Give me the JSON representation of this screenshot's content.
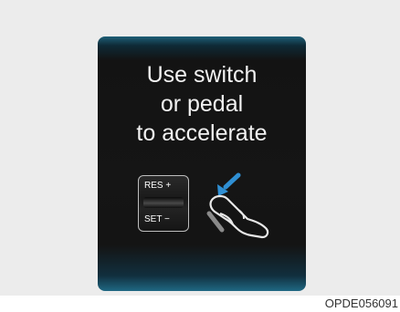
{
  "display": {
    "message_lines": [
      "Use switch",
      "or pedal",
      "to accelerate"
    ]
  },
  "switch": {
    "top_label": "RES +",
    "bottom_label": "SET −"
  },
  "caption": "OPDE056091",
  "colors": {
    "frame_background": "#ececec",
    "display_background": "#151515",
    "display_accent": "#1f6883",
    "arrow": "#2f8fd3",
    "text": "#f2f2f2"
  },
  "icons": [
    "res-set-switch-icon",
    "blue-arrow-icon",
    "foot-pedal-icon"
  ]
}
